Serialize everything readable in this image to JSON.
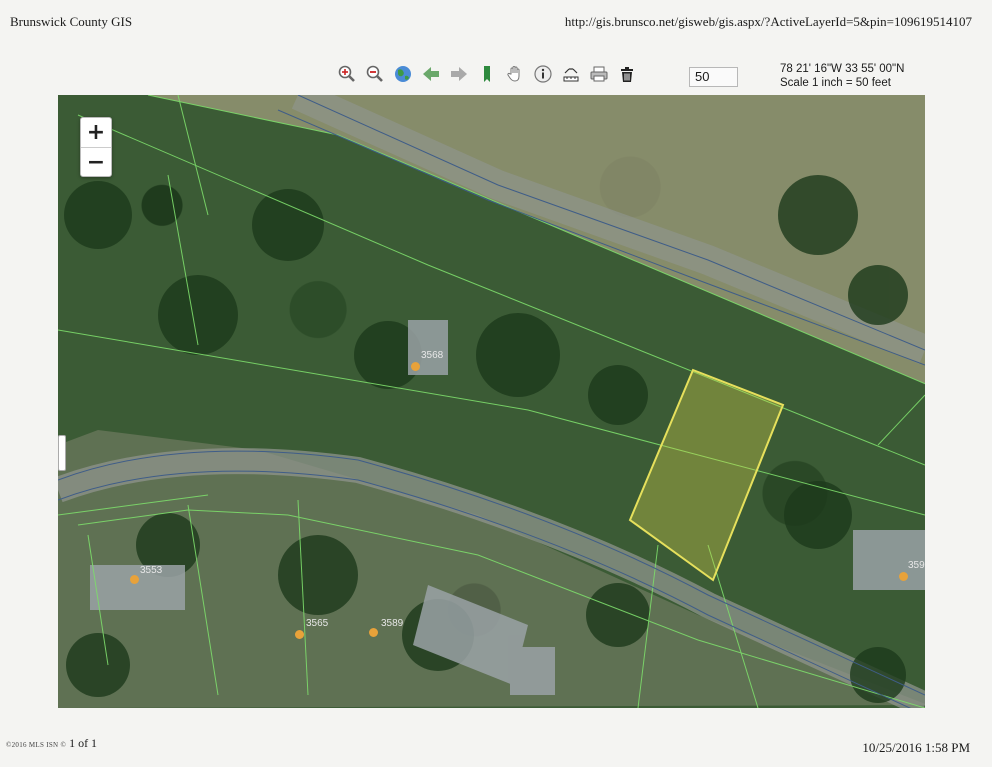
{
  "header": {
    "title": "Brunswick County GIS",
    "url": "http://gis.brunsco.net/gisweb/gis.aspx/?ActiveLayerId=5&pin=109619514107"
  },
  "toolbar": {
    "tools": [
      "zoom-in-icon",
      "zoom-out-icon",
      "globe-icon",
      "back-arrow-icon",
      "forward-arrow-icon",
      "bookmark-icon",
      "pan-hand-icon",
      "info-icon",
      "measure-icon",
      "print-icon",
      "trash-icon"
    ],
    "scale_value": "50"
  },
  "coords": {
    "line1": "78 21' 16\"W 33 55' 00\"N",
    "line2": "Scale 1 inch = 50 feet"
  },
  "map": {
    "zoom_in": "+",
    "zoom_out": "−",
    "parcel_labels": [
      "3568",
      "3553",
      "3565",
      "3589",
      "359"
    ],
    "colors": {
      "parcel_line": "#7ddc6b",
      "road_line": "#3f5d88",
      "selected_parcel": "#e6e05c",
      "parcel_point": "#e8a23a"
    }
  },
  "footer": {
    "page": "1 of 1",
    "copyright": "©2016 MLS ISN ©",
    "timestamp": "10/25/2016 1:58 PM"
  }
}
